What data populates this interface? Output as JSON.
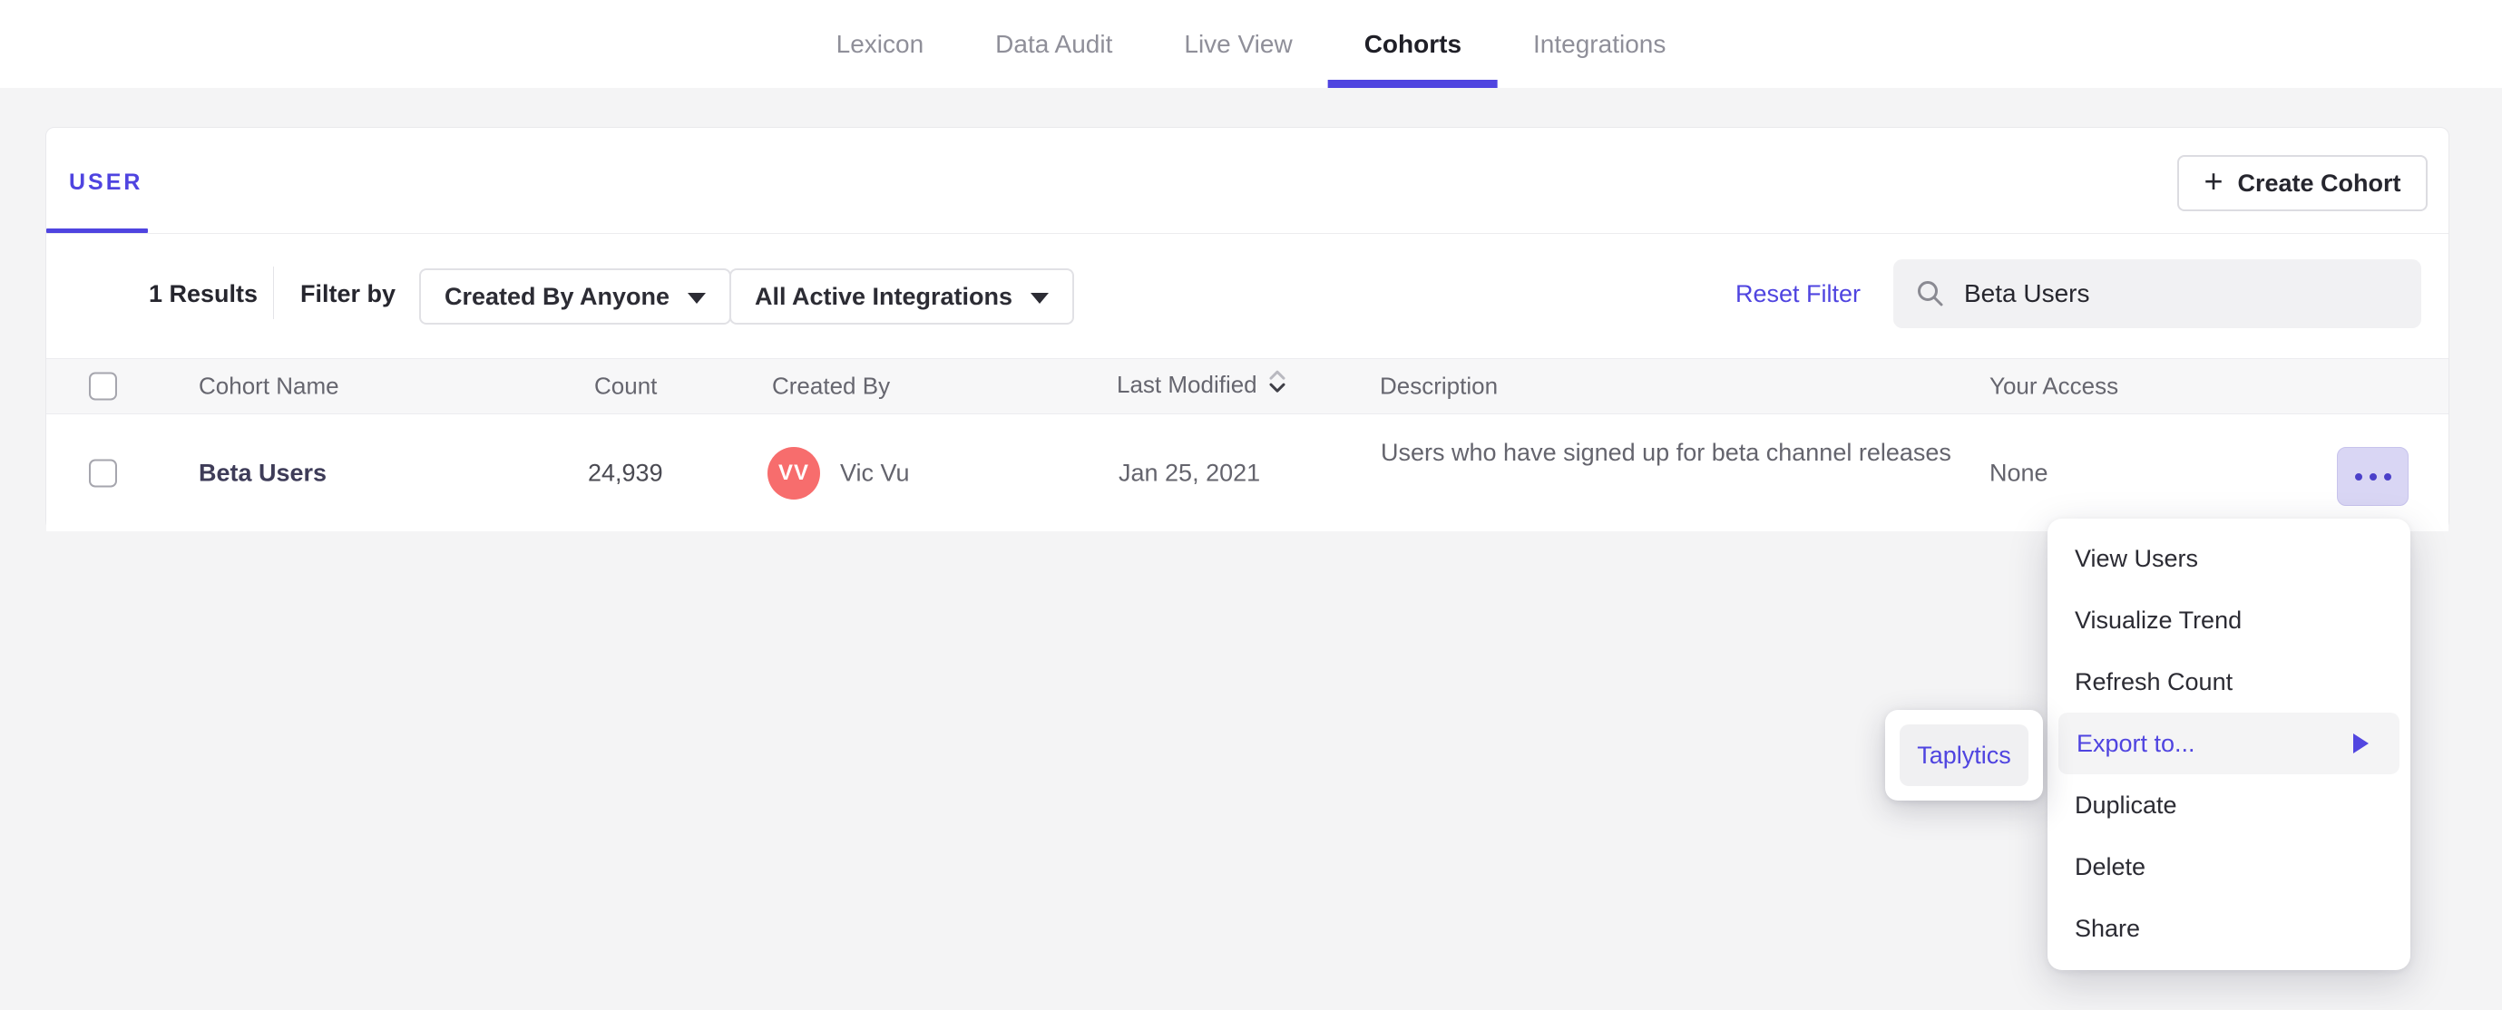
{
  "nav": {
    "tabs": [
      {
        "label": "Lexicon"
      },
      {
        "label": "Data Audit"
      },
      {
        "label": "Live View"
      },
      {
        "label": "Cohorts"
      },
      {
        "label": "Integrations"
      }
    ],
    "active_tab": "Cohorts"
  },
  "cohorts_page": {
    "type_tab": "USER",
    "create_cohort": {
      "plus": "+",
      "label": "Create Cohort"
    },
    "filters": {
      "results_count": "1 Results",
      "filter_by_label": "Filter by",
      "created_by_filter": "Created By Anyone",
      "integrations_filter": "All Active Integrations",
      "reset_filter_label": "Reset Filter",
      "search_value": "Beta Users"
    },
    "table": {
      "headers": {
        "name": "Cohort Name",
        "count": "Count",
        "created_by": "Created By",
        "last_modified": "Last Modified",
        "description": "Description",
        "access": "Your Access"
      },
      "rows": [
        {
          "name": "Beta Users",
          "count": "24,939",
          "avatar_initials": "VV",
          "created_by": "Vic Vu",
          "last_modified": "Jan 25, 2021",
          "description": "Users who have signed up for beta channel releases",
          "access": "None"
        }
      ]
    }
  },
  "context_menu": {
    "items": [
      "View Users",
      "Visualize Trend",
      "Refresh Count",
      "Export to...",
      "Duplicate",
      "Delete",
      "Share"
    ],
    "highlighted_item": "Export to..."
  },
  "export_submenu": {
    "items": [
      "Taplytics"
    ]
  },
  "colors": {
    "accent": "#4f44e0",
    "avatar": "#f76d6d",
    "dots_button_bg": "#d9d6f4",
    "highlight_bg": "#f4f4f5",
    "page_bg": "#f4f4f5"
  }
}
